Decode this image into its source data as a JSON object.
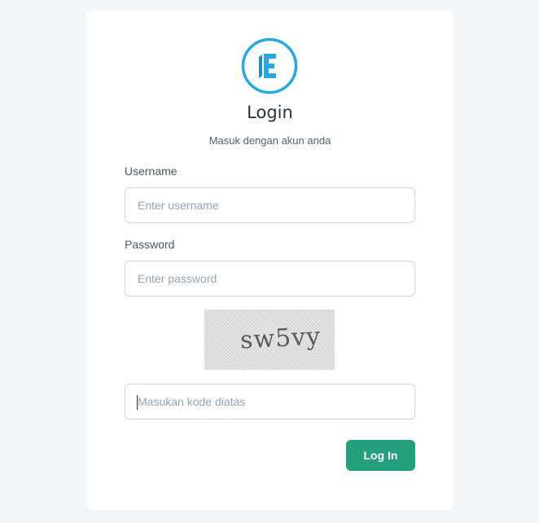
{
  "header": {
    "title": "Login",
    "subtitle": "Masuk dengan akun anda"
  },
  "form": {
    "username_label": "Username",
    "username_placeholder": "Enter username",
    "password_label": "Password",
    "password_placeholder": "Enter password",
    "captcha_text": "sw5vy",
    "captcha_placeholder": "Masukan kode diatas",
    "submit_label": "Log In"
  },
  "colors": {
    "accent": "#239f7e",
    "logo": "#29a8e0",
    "background": "#f3f6f9"
  },
  "icons": {
    "logo": "brand-logo-icon"
  }
}
